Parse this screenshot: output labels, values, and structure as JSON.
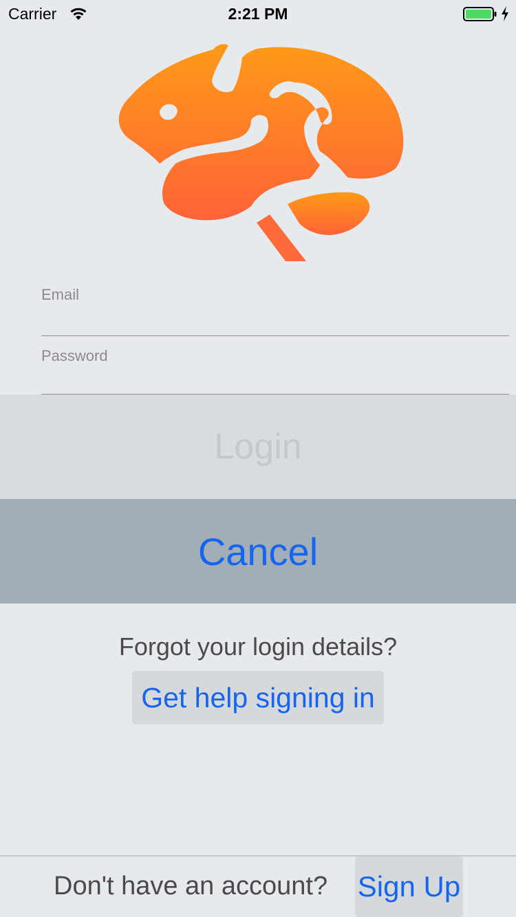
{
  "status_bar": {
    "carrier": "Carrier",
    "time": "2:21 PM",
    "wifi_icon": "wifi-icon",
    "battery_icon": "battery-icon",
    "battery_color": "#4cd964"
  },
  "logo": {
    "icon": "brain-icon",
    "gradient_top": "#ff9a17",
    "gradient_bottom": "#ff6338"
  },
  "form": {
    "email": {
      "label": "Email",
      "value": ""
    },
    "password": {
      "label": "Password",
      "value": ""
    }
  },
  "buttons": {
    "login_label": "Login",
    "cancel_label": "Cancel"
  },
  "help": {
    "prompt": "Forgot your login details?",
    "link_label": "Get help signing in"
  },
  "footer": {
    "prompt": "Don't have an account?",
    "signup_label": "Sign Up"
  },
  "colors": {
    "background": "#e7eaed",
    "accent": "#1565f0",
    "cancel_bg": "#a1aeb6",
    "login_bg": "#d8dcdf"
  }
}
